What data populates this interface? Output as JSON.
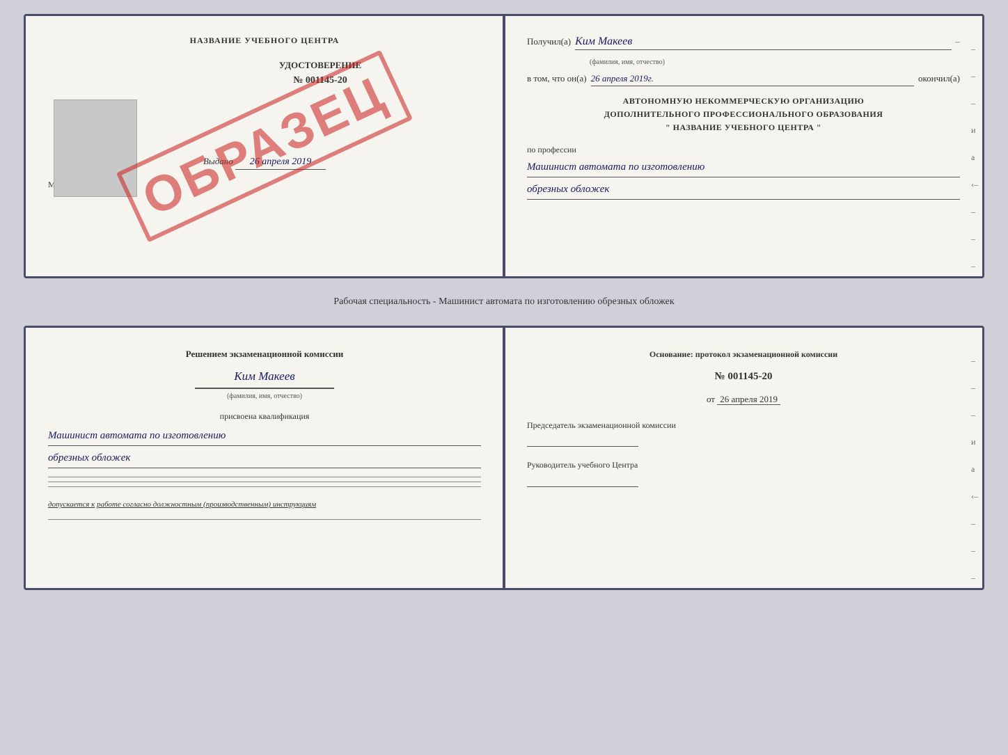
{
  "top_doc": {
    "left": {
      "title": "НАЗВАНИЕ УЧЕБНОГО ЦЕНТРА",
      "udostoverenie_label": "УДОСТОВЕРЕНИЕ",
      "number": "№ 001145-20",
      "issued_label": "Выдано",
      "issued_date": "26 апреля 2019",
      "mp_label": "М.П.",
      "stamp_text": "ОБРАЗЕЦ"
    },
    "right": {
      "poluchil_label": "Получил(а)",
      "poluchil_name": "Ким Макеев",
      "fio_sub": "(фамилия, имя, отчество)",
      "vtom_label": "в том, что он(а)",
      "vtom_date": "26 апреля 2019г.",
      "okonchil_label": "окончил(а)",
      "org_line1": "АВТОНОМНУЮ НЕКОММЕРЧЕСКУЮ ОРГАНИЗАЦИЮ",
      "org_line2": "ДОПОЛНИТЕЛЬНОГО ПРОФЕССИОНАЛЬНОГО ОБРАЗОВАНИЯ",
      "org_line3": "\" НАЗВАНИЕ УЧЕБНОГО ЦЕНТРА \"",
      "po_professii": "по профессии",
      "profession_line1": "Машинист автомата по изготовлению",
      "profession_line2": "обрезных обложек",
      "side_dashes": [
        "–",
        "–",
        "–",
        "и",
        "а",
        "‹–",
        "–",
        "–",
        "–",
        "–"
      ]
    }
  },
  "middle_text": "Рабочая специальность - Машинист автомата по изготовлению обрезных обложек",
  "bottom_doc": {
    "left": {
      "komissia_label": "Решением экзаменационной комиссии",
      "person_name": "Ким Макеев",
      "fio_sub": "(фамилия, имя, отчество)",
      "prisvoena_label": "присвоена квалификация",
      "qualification_line1": "Машинист автомата по изготовлению",
      "qualification_line2": "обрезных обложек",
      "dopuskaetsya_label": "допускается к",
      "dopuskaetsya_text": "работе согласно должностным (производственным) инструкциям"
    },
    "right": {
      "osnovanie_label": "Основание: протокол экзаменационной комиссии",
      "protocol_number": "№ 001145-20",
      "ot_label": "от",
      "ot_date": "26 апреля 2019",
      "predsedatel_label": "Председатель экзаменационной комиссии",
      "rukovoditel_label": "Руководитель учебного Центра",
      "side_dashes": [
        "–",
        "–",
        "–",
        "и",
        "а",
        "‹–",
        "–",
        "–",
        "–",
        "–"
      ]
    }
  }
}
